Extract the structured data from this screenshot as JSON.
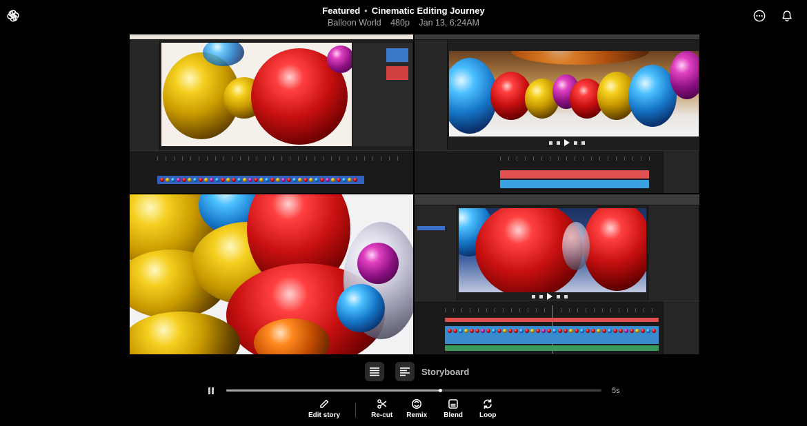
{
  "header": {
    "section": "Featured",
    "title": "Cinematic Editing Journey",
    "project": "Balloon World",
    "resolution": "480p",
    "date": "Jan 13, 6:24AM"
  },
  "icons": {
    "logo": "openai-logo-icon",
    "more": "more-options-icon",
    "notifications": "bell-icon"
  },
  "format": {
    "storyboard_label": "Storyboard"
  },
  "player": {
    "progress": 0.57,
    "duration": "5s"
  },
  "actions": [
    {
      "label": "Edit story",
      "icon": "pencil-icon"
    },
    {
      "label": "Re-cut",
      "icon": "scissors-icon"
    },
    {
      "label": "Remix",
      "icon": "remix-icon"
    },
    {
      "label": "Blend",
      "icon": "blend-icon"
    },
    {
      "label": "Loop",
      "icon": "loop-icon"
    }
  ],
  "colors": {
    "background": "#000000",
    "accent_track_red": "#e05050",
    "accent_track_blue": "#3aa0e0"
  }
}
